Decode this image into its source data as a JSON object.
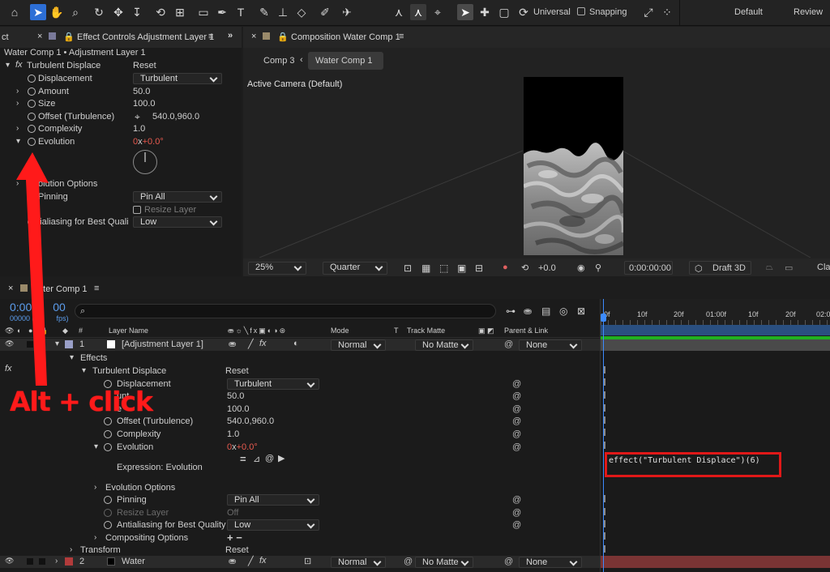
{
  "toolbar": {
    "universal": "Universal",
    "snapping": "Snapping",
    "default": "Default",
    "review": "Review"
  },
  "effect_panel": {
    "tab_left": "ct",
    "tab_title": "Effect Controls Adjustment Layer 1",
    "subtitle": "Water Comp 1 • Adjustment Layer 1",
    "effect_name": "Turbulent Displace",
    "reset": "Reset",
    "props": [
      {
        "label": "Displacement",
        "value": "Turbulent"
      },
      {
        "label": "Amount",
        "value": "50.0"
      },
      {
        "label": "Size",
        "value": "100.0"
      },
      {
        "label": "Offset (Turbulence)",
        "value": "540.0,960.0"
      },
      {
        "label": "Complexity",
        "value": "1.0"
      },
      {
        "label": "Evolution",
        "value_a": "0",
        "value_x": "x",
        "value_b": "+0.0°"
      },
      {
        "label": "olution Options"
      },
      {
        "label": "Pinning",
        "value": "Pin All"
      },
      {
        "label": "Resize Layer"
      },
      {
        "label": "ntialiasing for Best Quali",
        "value": "Low"
      }
    ]
  },
  "comp_panel": {
    "tab_title": "Composition Water Comp 1",
    "crumb1": "Comp 3",
    "crumb2": "Water Comp 1",
    "camera": "Active Camera (Default)",
    "zoom": "25%",
    "quality": "Quarter",
    "exposure": "+0.0",
    "timecode": "0:00:00:00",
    "renderer": "Draft 3D",
    "cla": "Cla"
  },
  "timeline": {
    "tab_title": "ater Comp 1",
    "timecode": "0:00",
    "timecode_hidden": "00",
    "frames": "00000 (3",
    "fps": "fps)",
    "ruler": [
      "0f",
      "10f",
      "20f",
      "01:00f",
      "10f",
      "20f",
      "02:0"
    ],
    "cols": {
      "hash": "#",
      "layer_name": "Layer Name",
      "mode": "Mode",
      "t": "T",
      "track_matte": "Track Matte",
      "parent": "Parent & Link"
    },
    "layer1": {
      "num": "1",
      "name": "[Adjustment Layer 1]",
      "mode": "Normal",
      "matte": "No Matte",
      "parent": "None"
    },
    "effects": "Effects",
    "effect_name": "Turbulent Displace",
    "reset": "Reset",
    "props": [
      {
        "label": "Displacement",
        "value": "Turbulent"
      },
      {
        "label": "unt",
        "value": "50.0"
      },
      {
        "label": "e",
        "value": "100.0"
      },
      {
        "label": "Offset (Turbulence)",
        "value": "540.0,960.0"
      },
      {
        "label": "Complexity",
        "value": "1.0"
      },
      {
        "label": "Evolution",
        "value_a": "0",
        "value_x": "x",
        "value_b": "+0.0°"
      }
    ],
    "expression_label": "Expression: Evolution",
    "expression_code": "effect(\"Turbulent Displace\")(6)",
    "props2": [
      {
        "label": "Evolution Options"
      },
      {
        "label": "Pinning",
        "value": "Pin All"
      },
      {
        "label": "Resize Layer",
        "value": "Off"
      },
      {
        "label": "Antialiasing for Best Quality",
        "value": "Low"
      },
      {
        "label": "Compositing Options",
        "value": "+ −"
      }
    ],
    "transform": "Transform",
    "transform_reset": "Reset",
    "layer2": {
      "num": "2",
      "name": "Water",
      "mode": "Normal",
      "matte": "No Matte",
      "parent": "None"
    }
  },
  "annotation": {
    "text": "Alt + click",
    "color": "#ff1a1a"
  }
}
